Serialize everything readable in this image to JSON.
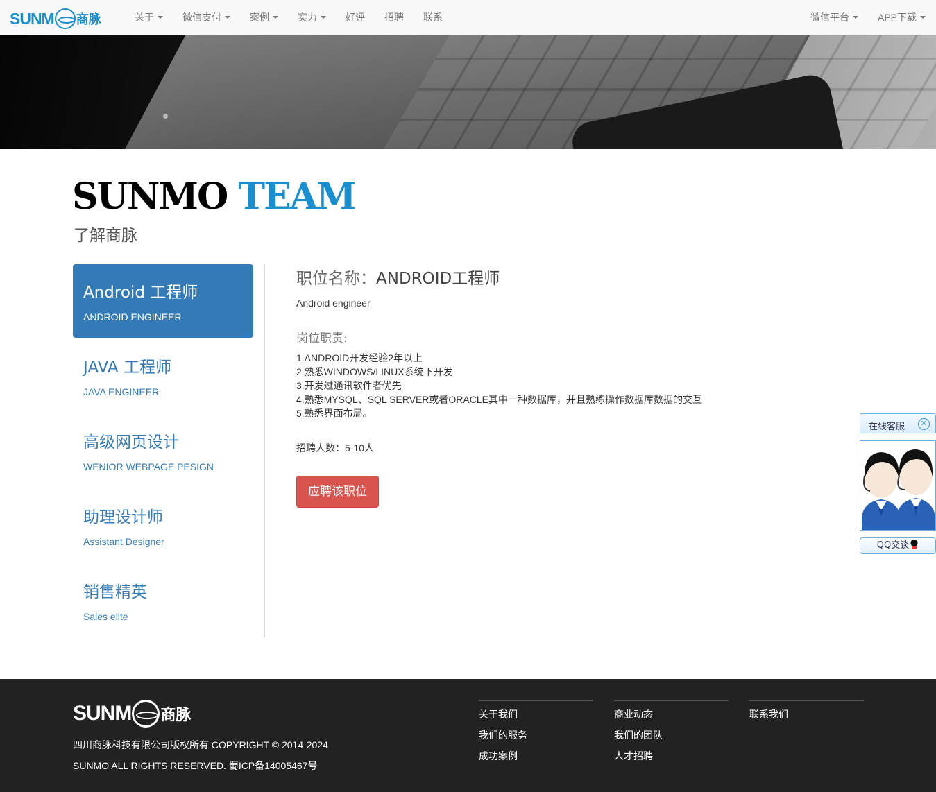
{
  "nav": {
    "brand_text": "SUNM",
    "brand_cn": "商脉",
    "left": [
      {
        "label": "关于",
        "dropdown": true
      },
      {
        "label": "微信支付",
        "dropdown": true
      },
      {
        "label": "案例",
        "dropdown": true
      },
      {
        "label": "实力",
        "dropdown": true
      },
      {
        "label": "好评",
        "dropdown": false
      },
      {
        "label": "招聘",
        "dropdown": false
      },
      {
        "label": "联系",
        "dropdown": false
      }
    ],
    "right": [
      {
        "label": "微信平台",
        "dropdown": true
      },
      {
        "label": "APP下载",
        "dropdown": true
      }
    ]
  },
  "page": {
    "title_word1": "SUNMO",
    "title_word2": "TEAM",
    "subtitle": "了解商脉"
  },
  "jobs": [
    {
      "cn": "Android 工程师",
      "en": "ANDROID ENGINEER",
      "active": true
    },
    {
      "cn": "JAVA 工程师",
      "en": "JAVA ENGINEER",
      "active": false
    },
    {
      "cn": "高级网页设计",
      "en": "WENIOR WEBPAGE PESIGN",
      "active": false
    },
    {
      "cn": "助理设计师",
      "en": "Assistant Designer",
      "active": false
    },
    {
      "cn": "销售精英",
      "en": "Sales elite",
      "active": false
    }
  ],
  "detail": {
    "title_label": "职位名称：",
    "title_value": "ANDROID工程师",
    "english_name": "Android engineer",
    "duty_heading": "岗位职责:",
    "duties": [
      "1.ANDROID开发经验2年以上",
      "2.熟悉WINDOWS/LINUX系统下开发",
      "3.开发过通讯软件者优先",
      "4.熟悉MYSQL、SQL SERVER或者ORACLE其中一种数据库，并且熟练操作数据库数据的交互",
      "5.熟悉界面布局。"
    ],
    "headcount": "招聘人数：5-10人",
    "apply_label": "应聘该职位"
  },
  "chat": {
    "tab_label": "在线客服",
    "close_icon": "close-icon",
    "qq_label": "QQ交谈"
  },
  "footer": {
    "logo_text": "SUNM",
    "logo_cn": "商脉",
    "copyright": "四川商脉科技有限公司版权所有 COPYRIGHT © 2014-2024",
    "rights": "SUNMO ALL RIGHTS RESERVED. 蜀ICP备14005467号",
    "col1": [
      "关于我们",
      "我们的服务",
      "成功案例"
    ],
    "col2": [
      "商业动态",
      "我们的团队",
      "人才招聘"
    ],
    "col3": [
      "联系我们"
    ]
  },
  "colors": {
    "accent": "#1a8fd0",
    "active_bg": "#337ab7",
    "apply_btn": "#d9534f",
    "footer_bg": "#222222"
  }
}
